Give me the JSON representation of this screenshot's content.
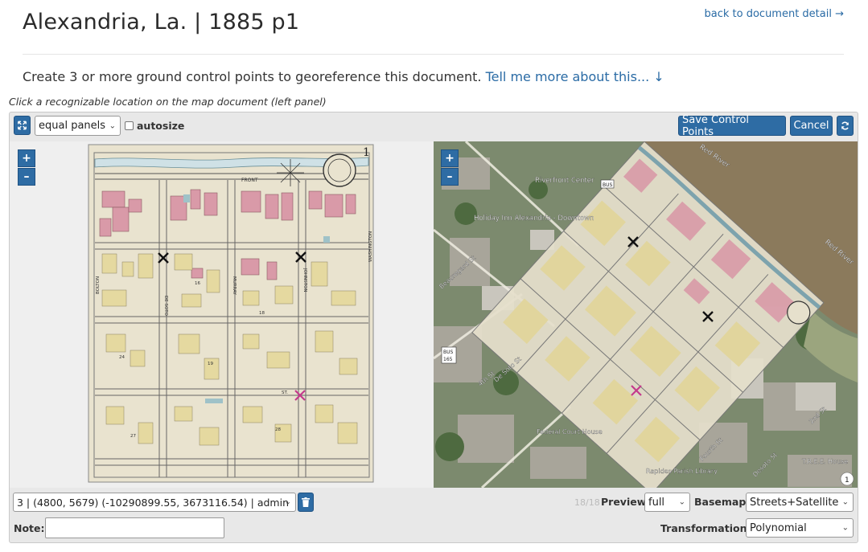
{
  "header": {
    "title": "Alexandria, La. | 1885 p1",
    "back_link": "back to document detail →"
  },
  "intro": {
    "text": "Create 3 or more ground control points to georeference this document.",
    "more_link": "Tell me more about this... ↓"
  },
  "hint": "Click a recognizable location on the map document (left panel)",
  "toolbar": {
    "panel_layout": "equal panels",
    "autosize_label": "autosize",
    "autosize_checked": false,
    "save_label": "Save Control Points",
    "cancel_label": "Cancel"
  },
  "left_map": {
    "sheet_number": "1",
    "front_label": "FRONT",
    "street_labels": [
      "BOLTON",
      "DE SOTO",
      "MURRAY",
      "JOHNSTON",
      "WASHINGTON"
    ],
    "block_numbers": [
      "16",
      "18",
      "19",
      "24",
      "27",
      "28"
    ],
    "st_label": "ST."
  },
  "right_map": {
    "labels": [
      "Red River",
      "Red River",
      "Riverfront Center",
      "Holiday Inn Alexandria - Downtown",
      "Beauregard St",
      "De Soto St",
      "4th St",
      "Federal Court House",
      "Rapides Parish Library",
      "2nd St",
      "Fourth St",
      "Desoto St",
      "T.R.E.E. House"
    ],
    "bus_shields": [
      "BUS",
      "BUS",
      "165"
    ],
    "scale_badge": "1"
  },
  "bottom": {
    "gcp_select": "3 | (4800, 5679) (-10290899.55, 3673116.54) | admin",
    "count_text": "18/18",
    "preview_label": "Preview",
    "preview_value": "full",
    "basemap_label": "Basemap",
    "basemap_value": "Streets+Satellite",
    "note_label": "Note:",
    "note_value": "",
    "transformation_label": "Transformation:",
    "transformation_value": "Polynomial"
  },
  "colors": {
    "accent": "#2e6ca4",
    "link": "#2a6ba5",
    "marker_black": "#111111",
    "marker_selected": "#c43a8c",
    "river": "#8b7a5c"
  }
}
